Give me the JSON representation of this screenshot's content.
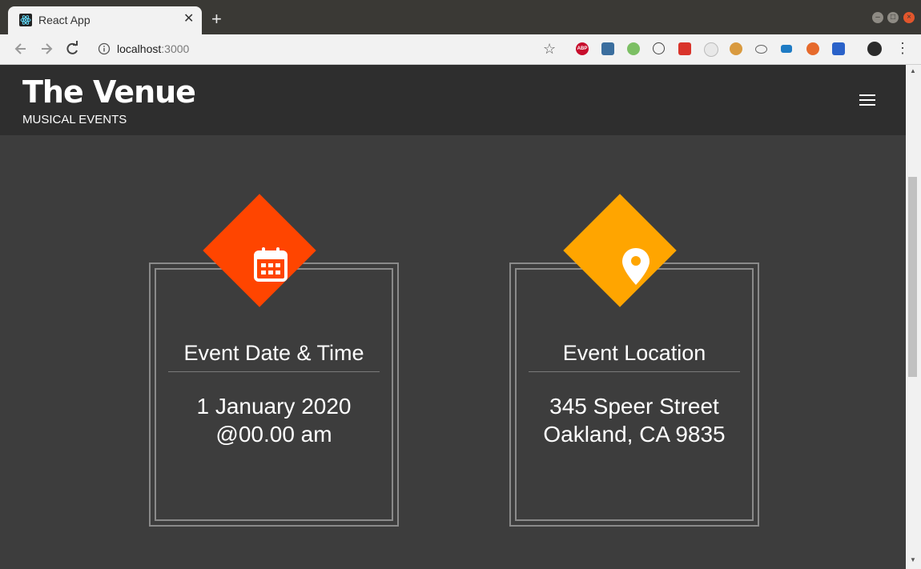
{
  "browser": {
    "tab_title": "React App",
    "tab_close": "✕",
    "new_tab": "+",
    "url_host": "localhost",
    "url_port": ":3000",
    "window_min": "–",
    "window_max": "□",
    "window_close": "×",
    "bookmark_star": "☆",
    "menu": "⋮",
    "extensions": [
      "ABP"
    ]
  },
  "header": {
    "brand": "The Venue",
    "tagline": "MUSICAL EVENTS"
  },
  "cards": [
    {
      "title": "Event Date & Time",
      "line1": "1 January 2020",
      "line2": "@00.00 am",
      "icon": "calendar-icon",
      "color": "#ff4500"
    },
    {
      "title": "Event Location",
      "line1": "345 Speer Street",
      "line2": "Oakland, CA 9835",
      "icon": "location-pin-icon",
      "color": "#ffa500"
    }
  ],
  "colors": {
    "header_bg": "#2e2e2e",
    "page_bg": "#3d3d3d"
  }
}
